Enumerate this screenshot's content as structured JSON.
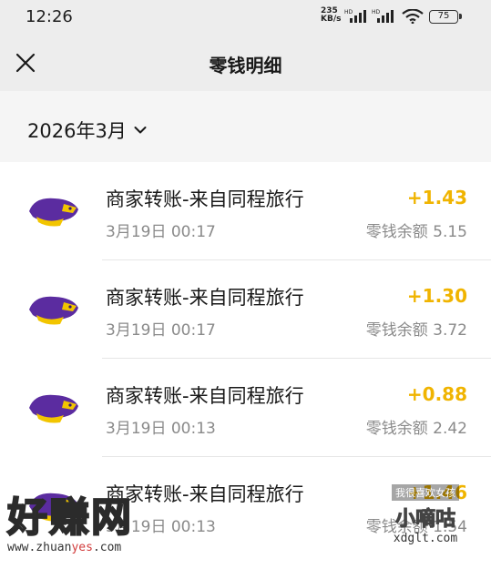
{
  "status_bar": {
    "time": "12:26",
    "net_speed": "235",
    "net_unit": "KB/s",
    "battery": "75"
  },
  "nav": {
    "title": "零钱明细"
  },
  "filter": {
    "month": "2026年3月"
  },
  "transactions": [
    {
      "title": "商家转账-来自同程旅行",
      "datetime": "3月19日 00:17",
      "amount": "+1.43",
      "balance": "零钱余额 5.15"
    },
    {
      "title": "商家转账-来自同程旅行",
      "datetime": "3月19日 00:17",
      "amount": "+1.30",
      "balance": "零钱余额 3.72"
    },
    {
      "title": "商家转账-来自同程旅行",
      "datetime": "3月19日 00:13",
      "amount": "+0.88",
      "balance": "零钱余额 2.42"
    },
    {
      "title": "商家转账-来自同程旅行",
      "datetime": "3月19日 00:13",
      "amount": "+1.46",
      "balance": "零钱余额 1.54"
    }
  ],
  "watermarks": {
    "left_big": "好赚网",
    "left_url_a": "www.zhuan",
    "left_url_b": "yes",
    "left_url_c": ".com",
    "right_small": "我很喜欢女孩",
    "right_big": "小嘀咕",
    "right_url": "xdglt.com"
  },
  "colors": {
    "amount": "#f0b400",
    "logo_purple": "#5b2ca0",
    "logo_yellow": "#f2c500"
  }
}
